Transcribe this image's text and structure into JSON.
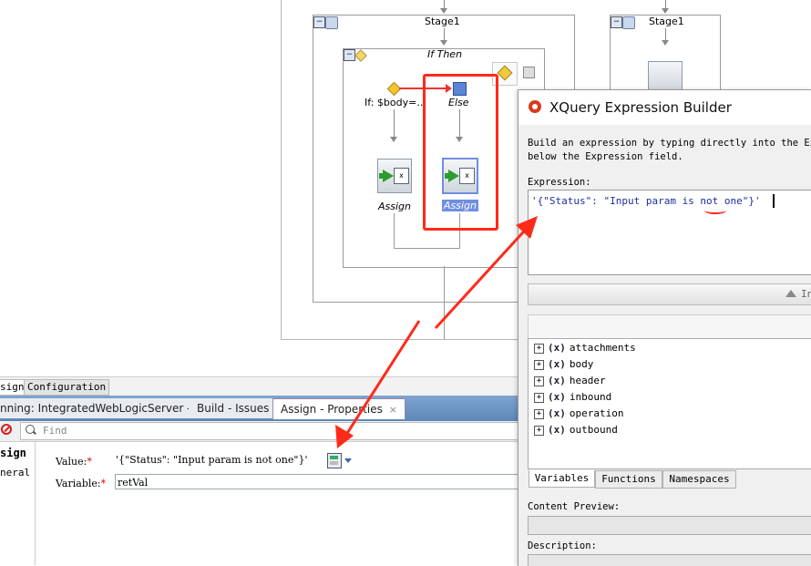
{
  "diagram": {
    "stage_left_title": "Stage1",
    "stage_right_title": "Stage1",
    "if_then_title": "If Then",
    "if_label": "If: $body=...",
    "else_label": "Else",
    "assign_left_label": "Assign",
    "assign_right_label": "Assign"
  },
  "panel_tabs": {
    "assign_tab": "sign",
    "configuration_tab": "Configuration"
  },
  "log_tabs": [
    {
      "label": "nning: IntegratedWebLogicServer - Log"
    },
    {
      "label": "Build - Issues"
    },
    {
      "label": "Assign - Properties"
    }
  ],
  "log_tab_close": "×",
  "properties": {
    "find_placeholder": "Find",
    "side_title": "sign",
    "side_item": "neral",
    "value_label": "Value:",
    "value_text": "'{\"Status\": \"Input param is not one\"}'",
    "variable_label": "Variable:",
    "variable_value": "retVal",
    "required_mark": "*"
  },
  "dialog": {
    "title": "XQuery Expression Builder",
    "instruction_line1": "Build an expression by typing directly into the Expr",
    "instruction_line2": "below the Expression field.",
    "expression_label": "Expression:",
    "expression_value": "'{\"Status\": \"Input param is not one\"}'",
    "insert_button": "In",
    "tree_items": [
      {
        "label": "attachments"
      },
      {
        "label": "body"
      },
      {
        "label": "header"
      },
      {
        "label": "inbound"
      },
      {
        "label": "operation"
      },
      {
        "label": "outbound"
      }
    ],
    "tree_expander": "+",
    "tree_var_icon": "(x)",
    "tabs": [
      {
        "label": "Variables"
      },
      {
        "label": "Functions"
      },
      {
        "label": "Namespaces"
      }
    ],
    "content_preview_label": "Content Preview:",
    "description_label": "Description:"
  },
  "colors": {
    "annotation_red": "#ff2a1a",
    "selection_blue": "#6f8fe0",
    "dialog_icon_red": "#d9391f"
  }
}
